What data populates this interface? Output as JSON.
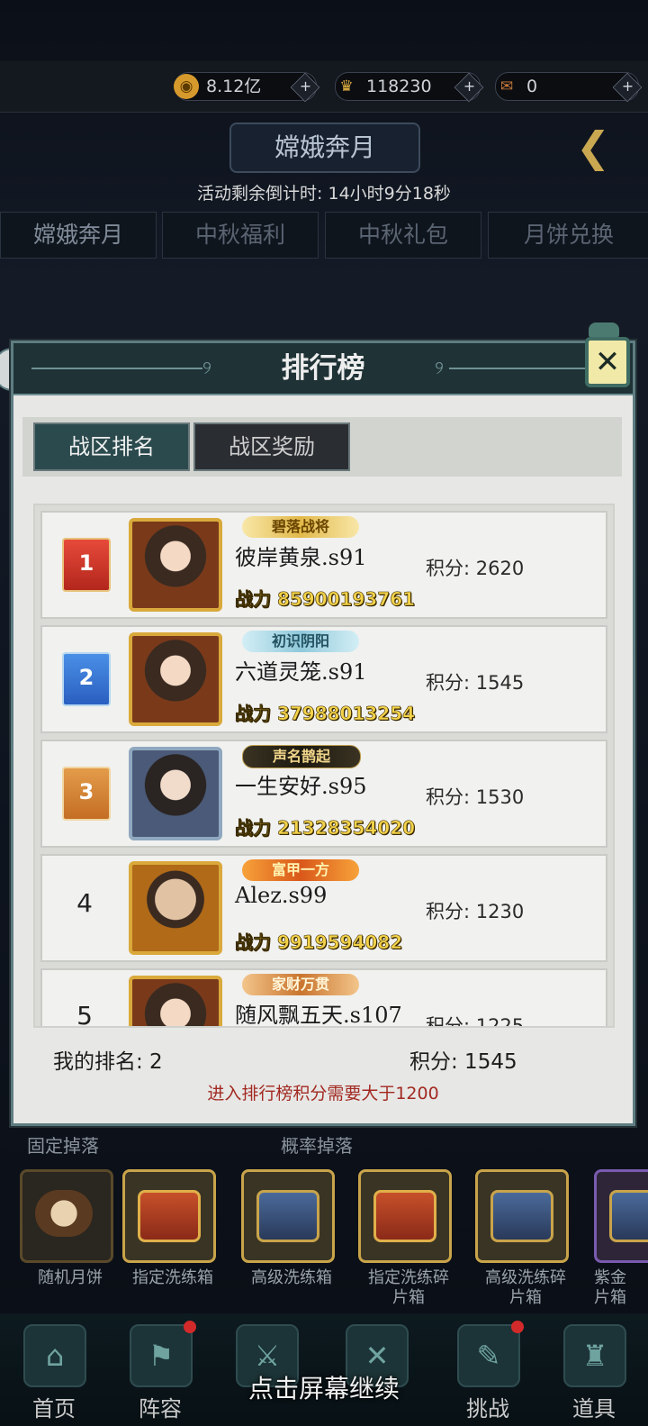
{
  "resources": [
    {
      "icon": "coin-icon",
      "symbol": "◉",
      "value": "8.12亿",
      "color": "#d69a2c"
    },
    {
      "icon": "ingot-icon",
      "symbol": "♛",
      "value": "118230",
      "color": "#e0b040"
    },
    {
      "icon": "scroll-icon",
      "symbol": "✉",
      "value": "0",
      "color": "#c87a3a"
    }
  ],
  "event": {
    "title": "嫦娥奔月",
    "countdown": "活动剩余倒计时: 14小时9分18秒",
    "tabs": [
      "嫦娥奔月",
      "中秋福利",
      "中秋礼包",
      "月饼兑换"
    ]
  },
  "leaderboard": {
    "title": "排行榜",
    "subtabs": [
      "战区排名",
      "战区奖励"
    ],
    "rows": [
      {
        "rank": "1",
        "badge": "碧落战将",
        "name": "彼岸黄泉.s91",
        "power": "战力 85900193761",
        "score": "积分: 2620"
      },
      {
        "rank": "2",
        "badge": "初识阴阳",
        "name": "六道灵笼.s91",
        "power": "战力 37988013254",
        "score": "积分: 1545"
      },
      {
        "rank": "3",
        "badge": "声名鹊起",
        "name": "一生安好.s95",
        "power": "战力 21328354020",
        "score": "积分: 1530"
      },
      {
        "rank": "4",
        "badge": "富甲一方",
        "name": "Alez.s99",
        "power": "战力 9919594082",
        "score": "积分: 1230"
      },
      {
        "rank": "5",
        "badge": "家财万贯",
        "name": "随风飘五天.s107",
        "power": "",
        "score": "积分: 1225"
      }
    ],
    "my_rank": "我的排名: 2",
    "my_score": "积分: 1545",
    "note": "进入排行榜积分需要大于1200"
  },
  "drops": {
    "fixed_label": "固定掉落",
    "chance_label": "概率掉落",
    "items": [
      {
        "name": "随机月饼",
        "kind": "cake"
      },
      {
        "name": "指定洗练箱",
        "kind": "chest-red"
      },
      {
        "name": "高级洗练箱",
        "kind": "chest-blue"
      },
      {
        "name": "指定洗练碎\n片箱",
        "kind": "chest-red"
      },
      {
        "name": "高级洗练碎\n片箱",
        "kind": "chest-blue"
      },
      {
        "name": "紫金\n片箱",
        "kind": "chest-blue"
      }
    ]
  },
  "nav": [
    {
      "label": "首页",
      "icon": "home-icon",
      "symbol": "⌂",
      "dot": false
    },
    {
      "label": "阵容",
      "icon": "formation-icon",
      "symbol": "⚑",
      "dot": true
    },
    {
      "label": "",
      "icon": "sword-icon",
      "symbol": "⚔",
      "dot": false
    },
    {
      "label": "",
      "icon": "battle-icon",
      "symbol": "✕",
      "dot": false
    },
    {
      "label": "挑战",
      "icon": "challenge-icon",
      "symbol": "✎",
      "dot": true
    },
    {
      "label": "道具",
      "icon": "bag-icon",
      "symbol": "♜",
      "dot": false
    }
  ],
  "tap_hint": "点击屏幕继续"
}
